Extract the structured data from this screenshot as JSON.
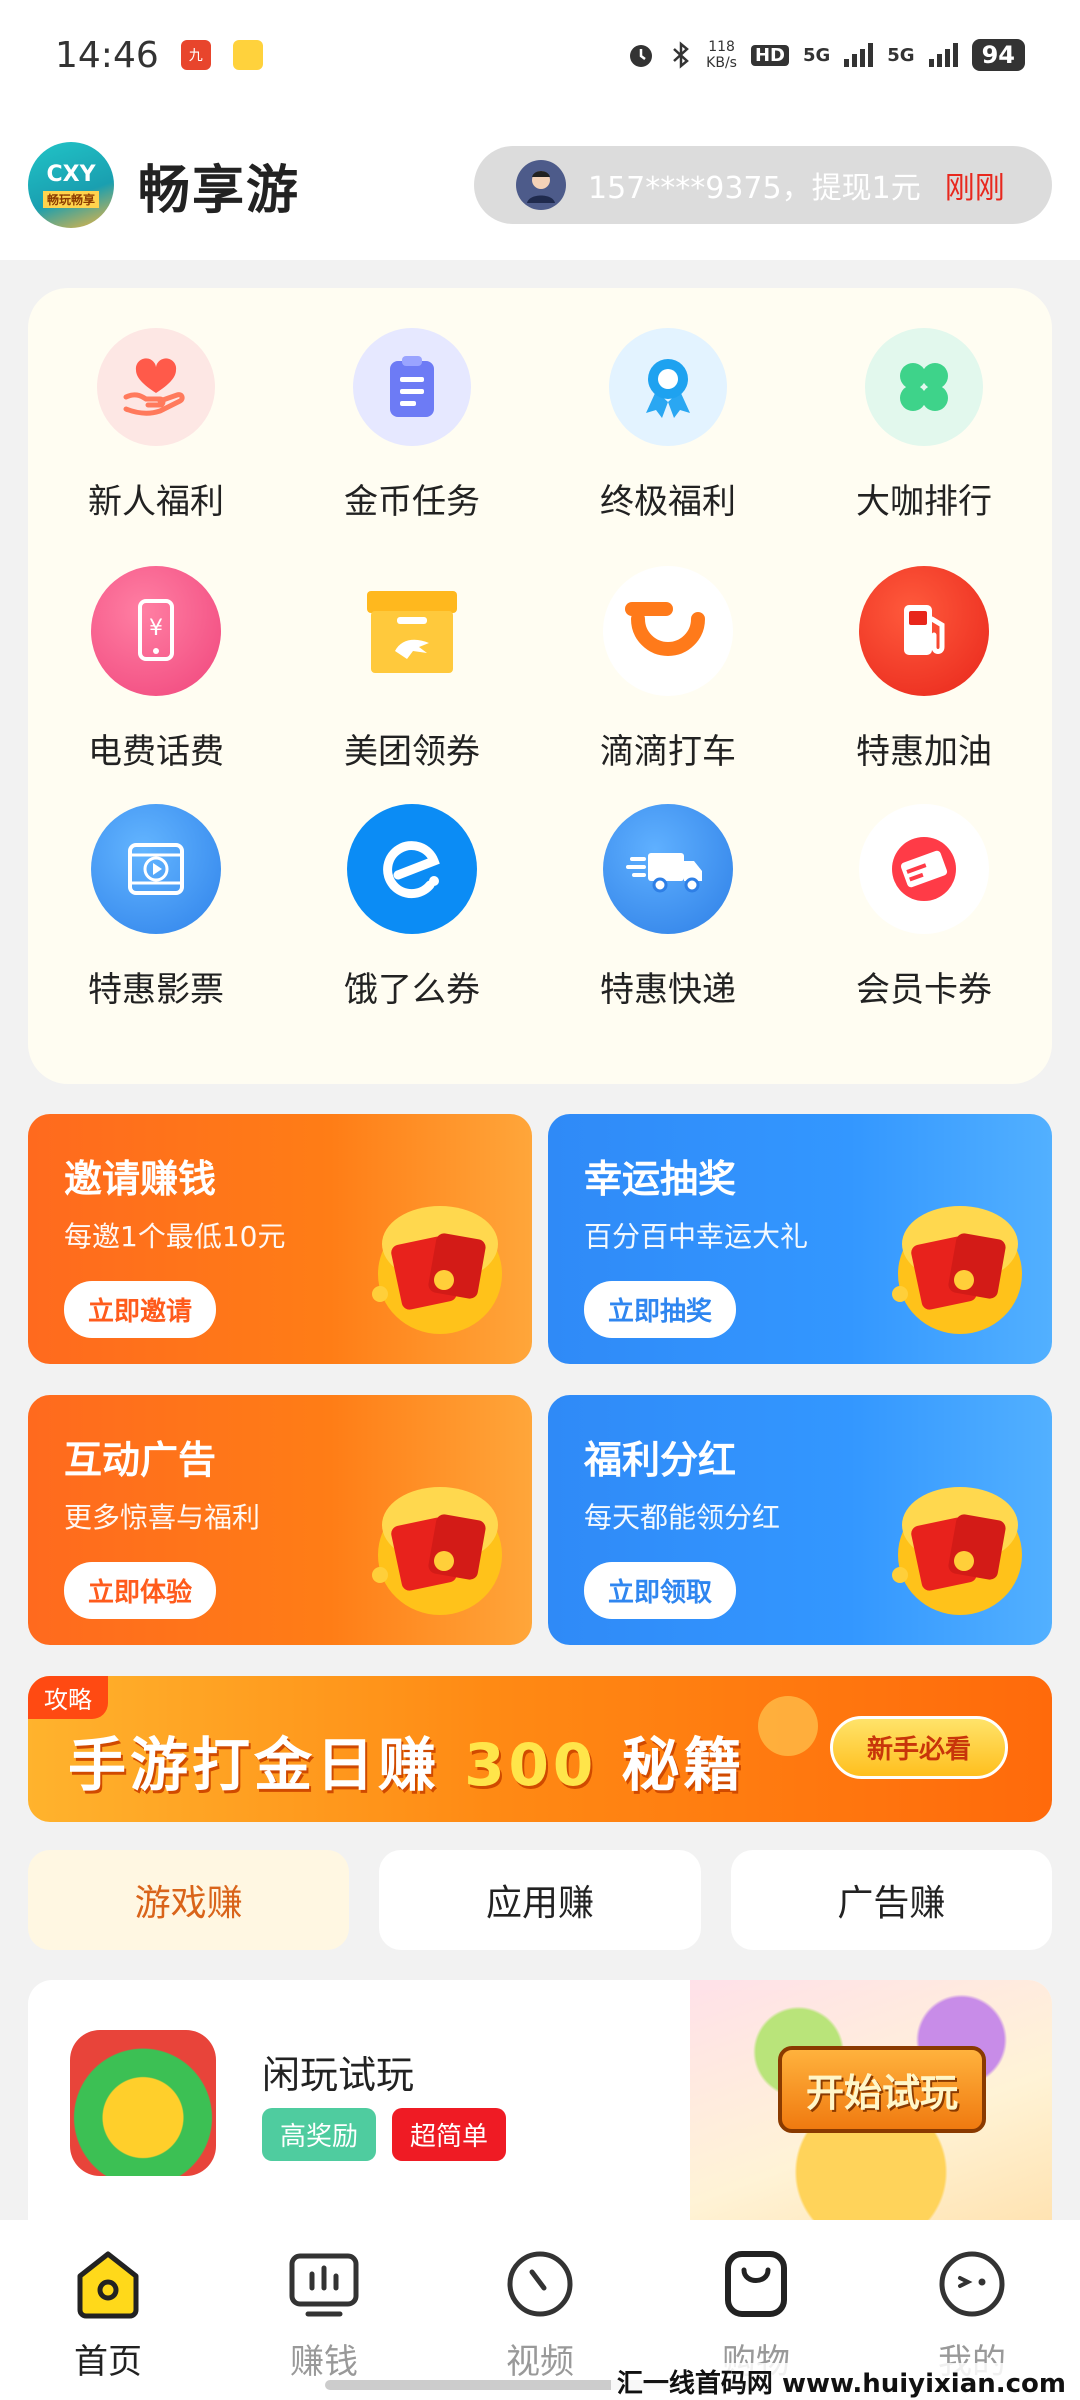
{
  "status_bar": {
    "time": "14:46",
    "net_speed_value": "118",
    "net_speed_unit": "KB/s",
    "hd_label": "HD",
    "signal1": "5G",
    "signal2": "5G",
    "battery": "94"
  },
  "header": {
    "app_name": "畅享游",
    "logo_text": "CXY",
    "logo_sub": "畅玩畅享",
    "ticker_message": "157****9375，提现1元",
    "ticker_time": "刚刚"
  },
  "grid": {
    "items": [
      {
        "label": "新人福利",
        "icon": "heart-hand-icon"
      },
      {
        "label": "金币任务",
        "icon": "clipboard-icon"
      },
      {
        "label": "终极福利",
        "icon": "award-ribbon-icon"
      },
      {
        "label": "大咖排行",
        "icon": "clover-icon"
      },
      {
        "label": "电费话费",
        "icon": "phone-yen-icon"
      },
      {
        "label": "美团领券",
        "icon": "meituan-icon"
      },
      {
        "label": "滴滴打车",
        "icon": "didi-icon"
      },
      {
        "label": "特惠加油",
        "icon": "fuel-pump-icon"
      },
      {
        "label": "特惠影票",
        "icon": "film-play-icon"
      },
      {
        "label": "饿了么券",
        "icon": "eleme-icon"
      },
      {
        "label": "特惠快递",
        "icon": "delivery-truck-icon"
      },
      {
        "label": "会员卡券",
        "icon": "vip-ticket-icon"
      }
    ]
  },
  "promos": [
    {
      "title": "邀请赚钱",
      "subtitle": "每邀1个最低10元",
      "button": "立即邀请"
    },
    {
      "title": "幸运抽奖",
      "subtitle": "百分百中幸运大礼",
      "button": "立即抽奖"
    },
    {
      "title": "互动广告",
      "subtitle": "更多惊喜与福利",
      "button": "立即体验"
    },
    {
      "title": "福利分红",
      "subtitle": "每天都能领分红",
      "button": "立即领取"
    }
  ],
  "banner": {
    "tag": "攻略",
    "text_before": "手游打金日赚 ",
    "text_number": "300",
    "text_after": " 秘籍",
    "button": "新手必看"
  },
  "tabs": [
    "游戏赚",
    "应用赚",
    "广告赚"
  ],
  "game": {
    "name": "闲玩试玩",
    "tags": [
      "高奖励",
      "超简单"
    ],
    "cta": "开始试玩"
  },
  "bottom_nav": [
    {
      "label": "首页",
      "icon": "home-icon"
    },
    {
      "label": "赚钱",
      "icon": "earn-chart-icon"
    },
    {
      "label": "视频",
      "icon": "video-gauge-icon"
    },
    {
      "label": "购物",
      "icon": "shopping-bag-icon"
    },
    {
      "label": "我的",
      "icon": "profile-face-icon"
    }
  ],
  "watermark": "汇一线首码网 www.huiyixian.com",
  "colors": {
    "accent_orange": "#ff6a1e",
    "accent_blue": "#2f8af7",
    "red": "#e8281e",
    "active_tab": "#d9641a"
  }
}
